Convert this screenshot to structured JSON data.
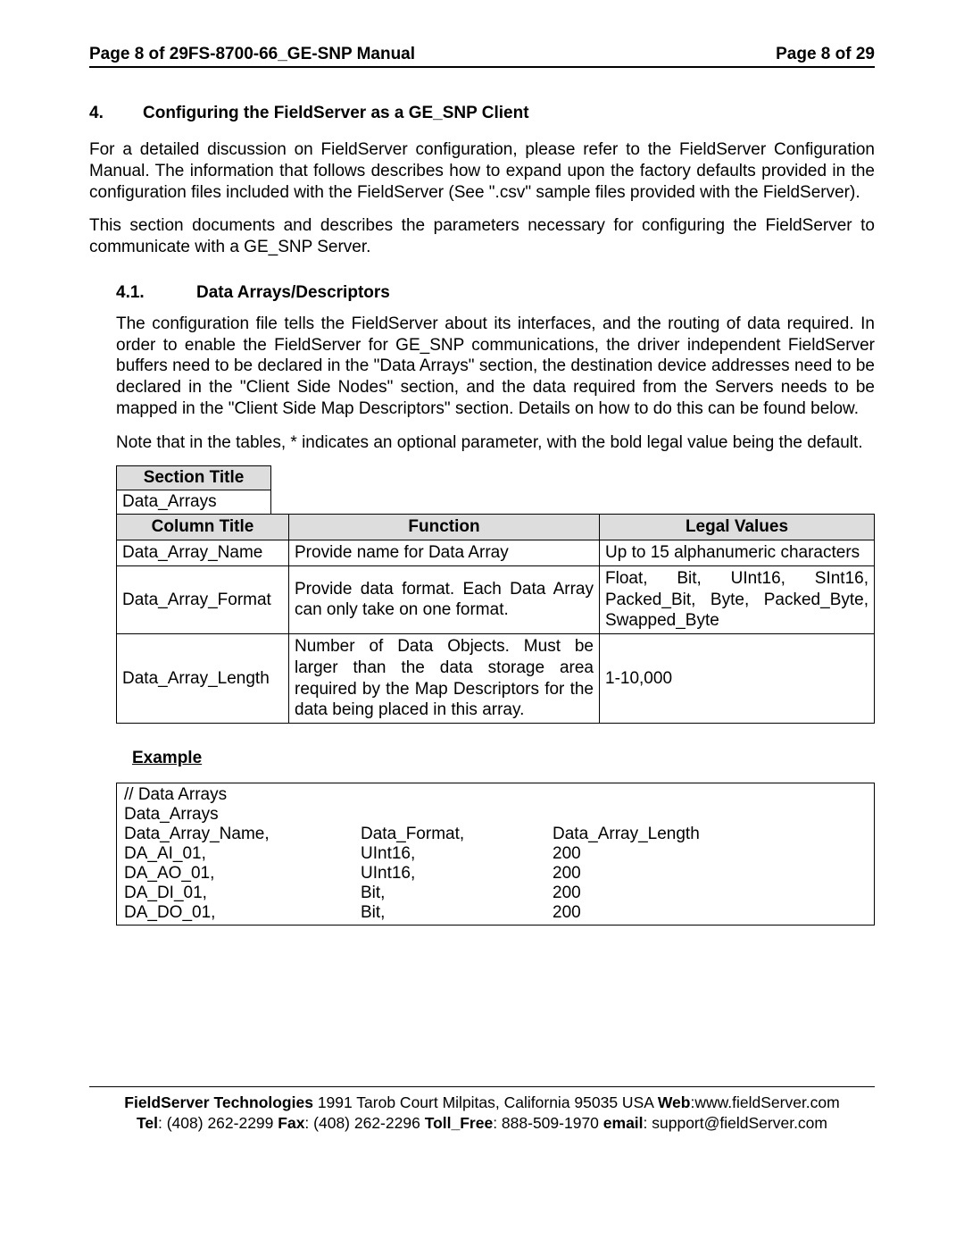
{
  "header": {
    "left": "Page 8 of 29FS-8700-66_GE-SNP Manual",
    "right": "Page 8 of 29"
  },
  "section": {
    "num": "4.",
    "title": "Configuring the FieldServer as a GE_SNP Client",
    "para1": "For a detailed discussion on FieldServer configuration, please refer to the FieldServer Configuration Manual.  The information that follows describes how to expand upon the factory defaults provided in the configuration files included with the FieldServer (See \".csv\" sample files provided with the FieldServer).",
    "para2": "This section documents and describes the parameters necessary for configuring the FieldServer to communicate with a GE_SNP Server."
  },
  "subsection": {
    "num": "4.1.",
    "title": "Data Arrays/Descriptors",
    "para1": "The configuration file tells the FieldServer about its interfaces, and the routing of data required.  In order to enable the FieldServer for GE_SNP communications, the driver independent FieldServer buffers need to be declared in the \"Data Arrays\" section, the destination device addresses need to be declared in the \"Client Side Nodes\" section, and the data required from the Servers needs to be mapped in the \"Client Side Map Descriptors\" section.  Details on how to do this can be found below.",
    "para2": "Note that in the tables, * indicates an optional parameter, with the bold legal value being the default."
  },
  "table1": {
    "section_title_hdr": "Section Title",
    "section_title_val": "Data_Arrays",
    "column_title": "Column Title",
    "function": "Function",
    "legal_values": "Legal Values",
    "rows": [
      {
        "c": "Data_Array_Name",
        "f": "Provide name for Data Array",
        "l": "Up to 15 alphanumeric characters"
      },
      {
        "c": "Data_Array_Format",
        "f": "Provide data format. Each Data Array can only take on one format.",
        "l": "Float, Bit, UInt16, SInt16, Packed_Bit, Byte, Packed_Byte, Swapped_Byte"
      },
      {
        "c": "Data_Array_Length",
        "f": "Number of Data Objects. Must be larger than the data storage area required by the Map Descriptors for the data being placed in this array.",
        "l": "1-10,000"
      }
    ]
  },
  "example": {
    "label": "Example",
    "lines": [
      {
        "c1": "//    Data Arrays",
        "c2": "",
        "c3": ""
      },
      {
        "c1": "Data_Arrays",
        "c2": "",
        "c3": ""
      },
      {
        "c1": "Data_Array_Name,",
        "c2": "Data_Format,",
        "c3": "Data_Array_Length"
      },
      {
        "c1": "DA_AI_01,",
        "c2": "UInt16,",
        "c3": "200"
      },
      {
        "c1": "DA_AO_01,",
        "c2": "UInt16,",
        "c3": "200"
      },
      {
        "c1": "DA_DI_01,",
        "c2": "Bit,",
        "c3": "200"
      },
      {
        "c1": "DA_DO_01,",
        "c2": "Bit,",
        "c3": "200"
      }
    ]
  },
  "footer": {
    "company": "FieldServer Technologies",
    "addr": " 1991 Tarob Court Milpitas, California 95035 USA  ",
    "web_lbl": "Web",
    "web_val": ":www.fieldServer.com",
    "tel_lbl": "Tel",
    "tel_val": ": (408) 262-2299   ",
    "fax_lbl": "Fax",
    "fax_val": ": (408) 262-2296   ",
    "toll_lbl": "Toll_Free",
    "toll_val": ": 888-509-1970   ",
    "email_lbl": "email",
    "email_val": ": support@fieldServer.com"
  }
}
